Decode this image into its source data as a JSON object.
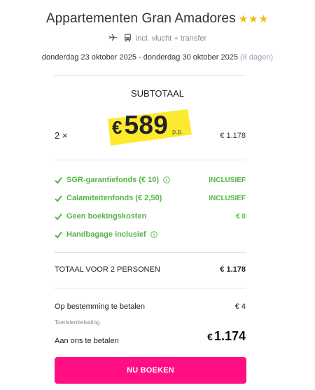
{
  "hotel": {
    "name": "Appartementen Gran Amadores",
    "stars": "★★★",
    "stars_color": "#f5b800",
    "transport_text": "incl. vlucht + transfer",
    "transport_icons": [
      "plane-icon",
      "bus-icon"
    ],
    "dates": "donderdag 23 oktober 2025 - donderdag 30 oktober 2025",
    "duration": "(8 dagen)"
  },
  "subtotal": {
    "title": "SUBTOTAAL",
    "quantity": "2 ×",
    "currency": "€",
    "price_pp": "589",
    "pp_label": "p.p.",
    "line_total": "€ 1.178",
    "highlight_color": "#fde92e"
  },
  "features": [
    {
      "label": "SGR-garantiefonds (€ 10)",
      "has_info": true,
      "value": "INCLUSIEF"
    },
    {
      "label": "Calamiteitenfonds (€ 2,50)",
      "has_info": false,
      "value": "INCLUSIEF"
    },
    {
      "label": "Geen boekingskosten",
      "has_info": false,
      "value": "€ 0"
    },
    {
      "label": "Handbagage inclusief",
      "has_info": true,
      "value": ""
    }
  ],
  "feature_color": "#55b447",
  "total": {
    "label": "TOTAAL VOOR 2 PERSONEN",
    "value": "€ 1.178"
  },
  "destination": {
    "label": "Op bestemming te betalen",
    "value": "€ 4",
    "note": "Toeristenbelasting"
  },
  "payment": {
    "label": "Aan ons te betalen",
    "currency": "€",
    "value": "1.174"
  },
  "book_button": {
    "label": "NU BOEKEN",
    "color": "#ff0f83"
  }
}
